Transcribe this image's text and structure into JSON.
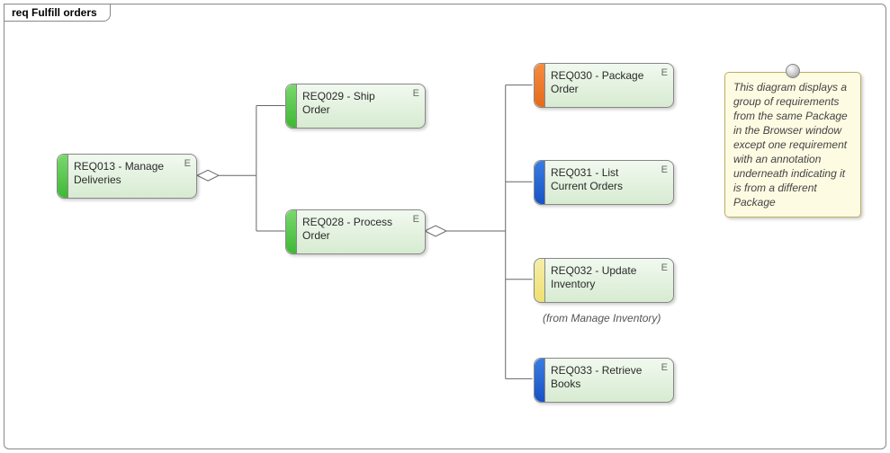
{
  "frame": {
    "title": "req Fulfill orders"
  },
  "marker": "E",
  "boxes": {
    "manage_deliveries": "REQ013 - Manage Deliveries",
    "ship_order": "REQ029 - Ship Order",
    "process_order": "REQ028 - Process Order",
    "package_order": "REQ030 - Package Order",
    "list_current_orders": "REQ031 - List Current Orders",
    "update_inventory": "REQ032 - Update Inventory",
    "retrieve_books": "REQ033 - Retrieve Books"
  },
  "annotation": "(from Manage Inventory)",
  "note": "This diagram displays a group of requirements from the same Package in the Browser window except one requirement with an annotation underneath indicating it is from a different Package"
}
